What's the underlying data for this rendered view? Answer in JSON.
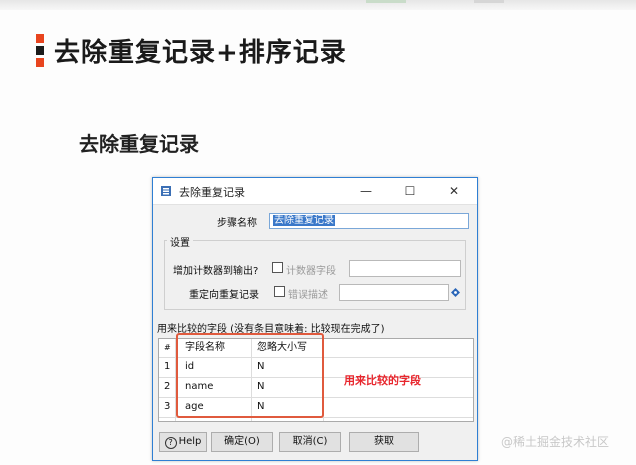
{
  "slide": {
    "title": "去除重复记录+排序记录",
    "subtitle": "去除重复记录"
  },
  "dialog": {
    "title": "去除重复记录",
    "minimize": "—",
    "maximize": "☐",
    "close": "✕",
    "step_name_label": "步骤名称",
    "step_name_value": "去除重复记录",
    "settings_label": "设置",
    "add_counter_label": "增加计数器到输出?",
    "counter_field_placeholder": "计数器字段",
    "redirect_label": "重定向重复记录",
    "error_desc_placeholder": "错误描述",
    "fields_label": "用来比较的字段 (没有条目意味着: 比较现在完成了)",
    "table": {
      "columns": [
        "#",
        "字段名称",
        "忽略大小写"
      ],
      "rows": [
        {
          "num": "1",
          "name": "id",
          "ignore_case": "N"
        },
        {
          "num": "2",
          "name": "name",
          "ignore_case": "N"
        },
        {
          "num": "3",
          "name": "age",
          "ignore_case": "N"
        }
      ]
    },
    "buttons": {
      "help": "Help",
      "ok": "确定(O)",
      "cancel": "取消(C)",
      "get": "获取"
    }
  },
  "annotation": "用来比较的字段",
  "watermark": "@稀土掘金技术社区",
  "colors": {
    "accent_red": "#e8262d",
    "window_border": "#2f7fd3",
    "selection": "#3a78c9"
  }
}
